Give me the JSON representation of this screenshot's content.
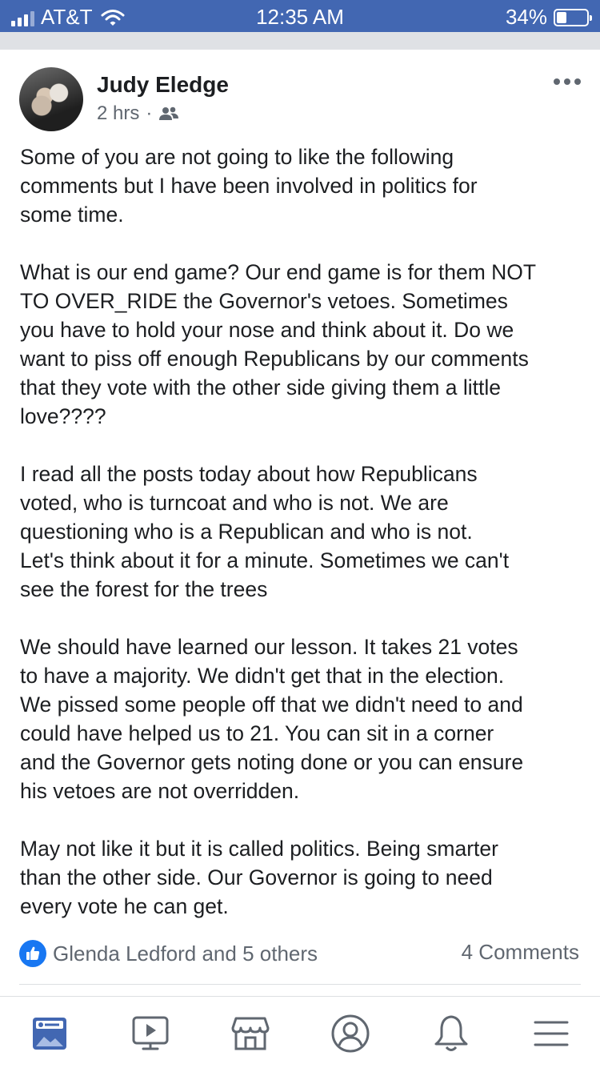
{
  "status_bar": {
    "carrier": "AT&T",
    "time": "12:35 AM",
    "battery": "34%",
    "battery_level": 0.34,
    "signal_bars": 3
  },
  "post": {
    "author": "Judy Eledge",
    "time": "2 hrs",
    "separator": "·",
    "audience_icon": "friends-icon",
    "paragraphs": [
      "Some of you are not going to like the following\ncomments but I have been involved in politics for\nsome time.",
      "What is our end game? Our end game is for them NOT\nTO OVER_RIDE the Governor's vetoes.  Sometimes\nyou have to hold your nose and think about it.  Do we\nwant to piss off enough Republicans by our comments\nthat they vote with the other side giving them a little\nlove????",
      "I read all the posts today about how Republicans\nvoted, who is turncoat and who is not. We are\nquestioning who is a Republican and who is not.\nLet's think about it for a minute. Sometimes we can't\nsee the forest for the trees",
      "We should have learned our lesson. It takes 21 votes\nto have a majority.  We didn't get that in the election.\nWe pissed some people off that we didn't need to and\ncould have helped us to 21.   You can sit in a corner\nand the Governor gets noting done or you can ensure\nhis vetoes are not overridden.",
      "May not like it but it is called politics. Being smarter\nthan the other side.  Our Governor is going to need\nevery vote he  can get."
    ],
    "reactions_text": "Glenda Ledford and 5 others",
    "comments_text": "4 Comments"
  },
  "tabbar": {
    "tabs": [
      {
        "icon": "news-feed-icon",
        "active": true
      },
      {
        "icon": "watch-icon",
        "active": false
      },
      {
        "icon": "marketplace-icon",
        "active": false
      },
      {
        "icon": "profile-icon",
        "active": false
      },
      {
        "icon": "notifications-icon",
        "active": false
      },
      {
        "icon": "menu-icon",
        "active": false
      }
    ]
  },
  "colors": {
    "brand": "#4267b2",
    "like_blue": "#1877f2",
    "secondary_text": "#606770",
    "icon_gray": "#606770"
  }
}
